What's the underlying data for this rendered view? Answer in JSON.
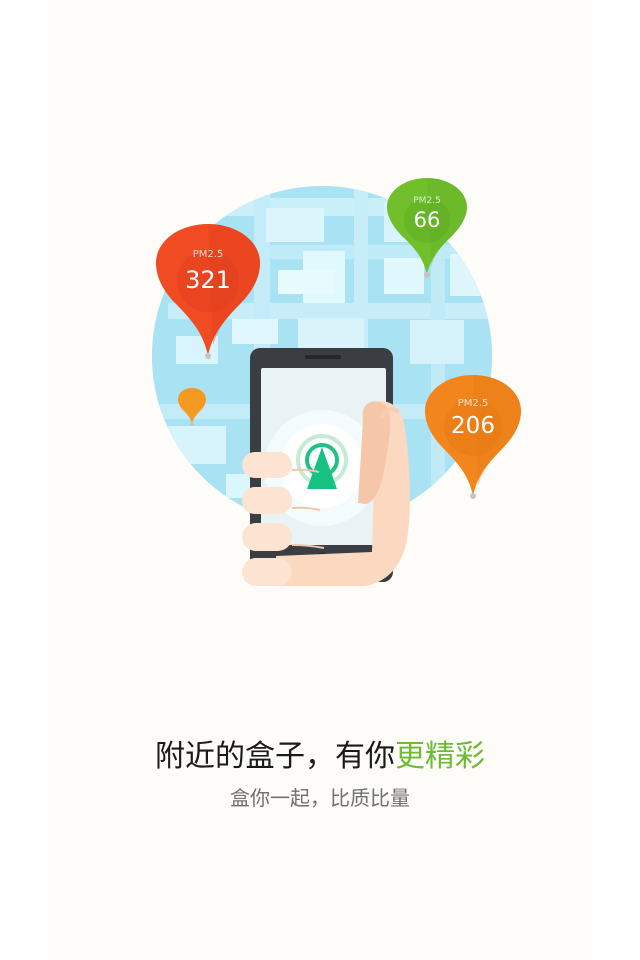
{
  "markers": [
    {
      "id": "red",
      "label": "PM2.5",
      "value": "321",
      "color": "#f04b22"
    },
    {
      "id": "green",
      "label": "PM2.5",
      "value": "66",
      "color": "#71bf2b"
    },
    {
      "id": "orange",
      "label": "PM2.5",
      "value": "206",
      "color": "#f2861c"
    }
  ],
  "headline": {
    "main": "附近的盒子，有你",
    "highlight": "更精彩"
  },
  "subtitle": "盒你一起，比质比量",
  "colors": {
    "background": "#fdfcf8",
    "map": "#a9e3f3",
    "headline_highlight": "#6dbb35"
  },
  "icons": [
    "map-globe-icon",
    "location-pin-icon",
    "smartphone-icon",
    "hand-icon",
    "radar-navigation-icon"
  ]
}
